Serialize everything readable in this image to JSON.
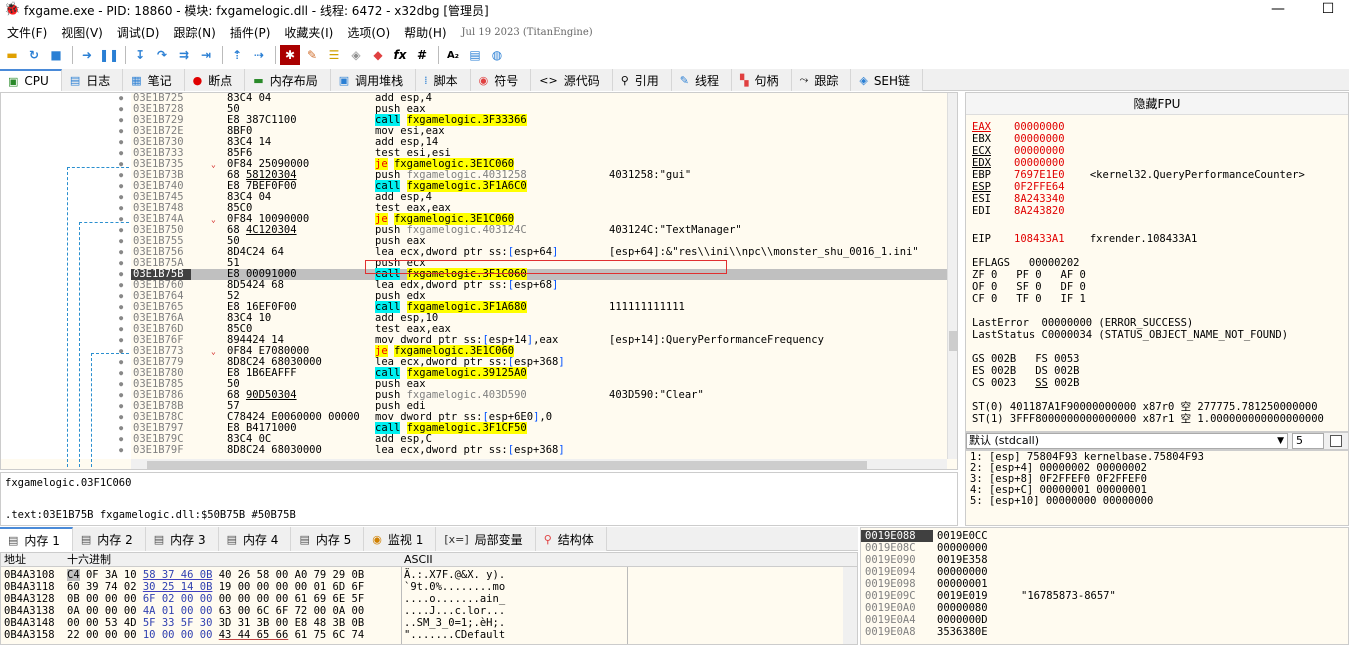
{
  "window": {
    "title": "fxgame.exe - PID: 18860 - 模块: fxgamelogic.dll - 线程: 6472 - x32dbg [管理员]",
    "app_icon": "bug-icon",
    "min_glyph": "—",
    "max_glyph": "☐"
  },
  "menu": [
    "文件(F)",
    "视图(V)",
    "调试(D)",
    "跟踪(N)",
    "插件(P)",
    "收藏夹(I)",
    "选项(O)",
    "帮助(H)"
  ],
  "build_date": "Jul 19 2023 (TitanEngine)",
  "toolbar": [
    "open-icon",
    "restart-icon",
    "stop-icon",
    "run-icon",
    "pause-icon",
    "step-into-icon",
    "step-over-icon",
    "trace-into-icon",
    "trace-over-icon",
    "execute-till-return-icon",
    "run-to-user-code-icon",
    "scylla-icon",
    "patch-icon",
    "comment-icon",
    "label-icon",
    "bookmark-icon",
    "function-icon",
    "hash-icon",
    "font-icon",
    "list-icon",
    "globe-icon"
  ],
  "tabs": [
    {
      "label": "CPU",
      "icon": "cpu-icon"
    },
    {
      "label": "日志",
      "icon": "log-icon"
    },
    {
      "label": "笔记",
      "icon": "notes-icon"
    },
    {
      "label": "断点",
      "icon": "breakpoint-icon"
    },
    {
      "label": "内存布局",
      "icon": "memory-map-icon"
    },
    {
      "label": "调用堆栈",
      "icon": "callstack-icon"
    },
    {
      "label": "脚本",
      "icon": "script-icon"
    },
    {
      "label": "符号",
      "icon": "symbol-icon"
    },
    {
      "label": "源代码",
      "icon": "source-icon"
    },
    {
      "label": "引用",
      "icon": "references-icon"
    },
    {
      "label": "线程",
      "icon": "threads-icon"
    },
    {
      "label": "句柄",
      "icon": "handles-icon"
    },
    {
      "label": "跟踪",
      "icon": "trace-icon"
    },
    {
      "label": "SEH链",
      "icon": "seh-icon"
    }
  ],
  "disasm": [
    {
      "addr": "03E1B725",
      "bytes": "83C4 04",
      "instr": "add esp,4",
      "cmt": ""
    },
    {
      "addr": "03E1B728",
      "bytes": "50",
      "instr": "push eax",
      "cmt": ""
    },
    {
      "addr": "03E1B729",
      "bytes": "E8 387C1100",
      "instr": "call fxgamelogic.3F33366",
      "cmt": "",
      "hl": "call"
    },
    {
      "addr": "03E1B72E",
      "bytes": "8BF0",
      "instr": "mov esi,eax",
      "cmt": ""
    },
    {
      "addr": "03E1B730",
      "bytes": "83C4 14",
      "instr": "add esp,14",
      "cmt": ""
    },
    {
      "addr": "03E1B733",
      "bytes": "85F6",
      "instr": "test esi,esi",
      "cmt": ""
    },
    {
      "addr": "03E1B735",
      "bytes": "0F84 25090000",
      "instr": "je fxgamelogic.3E1C060",
      "cmt": "",
      "hl": "je",
      "arrow": "v"
    },
    {
      "addr": "03E1B73B",
      "bytes": "68 58120304",
      "instr": "push fxgamelogic.4031258",
      "cmt": "4031258:\"gui\"",
      "bytes_ul": "58120304",
      "grey": true
    },
    {
      "addr": "03E1B740",
      "bytes": "E8 7BEF0F00",
      "instr": "call fxgamelogic.3F1A6C0",
      "cmt": "",
      "hl": "call"
    },
    {
      "addr": "03E1B745",
      "bytes": "83C4 04",
      "instr": "add esp,4",
      "cmt": ""
    },
    {
      "addr": "03E1B748",
      "bytes": "85C0",
      "instr": "test eax,eax",
      "cmt": ""
    },
    {
      "addr": "03E1B74A",
      "bytes": "0F84 10090000",
      "instr": "je fxgamelogic.3E1C060",
      "cmt": "",
      "hl": "je",
      "arrow": "v"
    },
    {
      "addr": "03E1B750",
      "bytes": "68 4C120304",
      "instr": "push fxgamelogic.403124C",
      "cmt": "403124C:\"TextManager\"",
      "bytes_ul": "4C120304",
      "grey": true
    },
    {
      "addr": "03E1B755",
      "bytes": "50",
      "instr": "push eax",
      "cmt": ""
    },
    {
      "addr": "03E1B756",
      "bytes": "8D4C24 64",
      "instr": "lea ecx,dword ptr ss:[esp+64]",
      "cmt": "[esp+64]:&\"res\\\\ini\\\\npc\\\\monster_shu_0016_1.ini\""
    },
    {
      "addr": "03E1B75A",
      "bytes": "51",
      "instr": "push ecx",
      "cmt": ""
    },
    {
      "addr": "03E1B75B",
      "bytes": "E8 00091000",
      "instr": "call fxgamelogic.3F1C060",
      "cmt": "",
      "hl": "call",
      "cur": true
    },
    {
      "addr": "03E1B760",
      "bytes": "8D5424 68",
      "instr": "lea edx,dword ptr ss:[esp+68]",
      "cmt": ""
    },
    {
      "addr": "03E1B764",
      "bytes": "52",
      "instr": "push edx",
      "cmt": ""
    },
    {
      "addr": "03E1B765",
      "bytes": "E8 16EF0F00",
      "instr": "call fxgamelogic.3F1A680",
      "cmt": "111111111111",
      "hl": "call"
    },
    {
      "addr": "03E1B76A",
      "bytes": "83C4 10",
      "instr": "add esp,10",
      "cmt": ""
    },
    {
      "addr": "03E1B76D",
      "bytes": "85C0",
      "instr": "test eax,eax",
      "cmt": ""
    },
    {
      "addr": "03E1B76F",
      "bytes": "894424 14",
      "instr": "mov dword ptr ss:[esp+14],eax",
      "cmt": "[esp+14]:QueryPerformanceFrequency"
    },
    {
      "addr": "03E1B773",
      "bytes": "0F84 E7080000",
      "instr": "je fxgamelogic.3E1C060",
      "cmt": "",
      "hl": "je",
      "arrow": "v"
    },
    {
      "addr": "03E1B779",
      "bytes": "8D8C24 68030000",
      "instr": "lea ecx,dword ptr ss:[esp+368]",
      "cmt": ""
    },
    {
      "addr": "03E1B780",
      "bytes": "E8 1B6EAFFF",
      "instr": "call fxgamelogic.39125A0",
      "cmt": "",
      "hl": "call"
    },
    {
      "addr": "03E1B785",
      "bytes": "50",
      "instr": "push eax",
      "cmt": ""
    },
    {
      "addr": "03E1B786",
      "bytes": "68 90D50304",
      "instr": "push fxgamelogic.403D590",
      "cmt": "403D590:\"Clear\"",
      "bytes_ul": "90D50304",
      "grey": true
    },
    {
      "addr": "03E1B78B",
      "bytes": "57",
      "instr": "push edi",
      "cmt": ""
    },
    {
      "addr": "03E1B78C",
      "bytes": "C78424 E0060000 00000",
      "instr": "mov dword ptr ss:[esp+6E0],0",
      "cmt": ""
    },
    {
      "addr": "03E1B797",
      "bytes": "E8 B4171000",
      "instr": "call fxgamelogic.3F1CF50",
      "cmt": "",
      "hl": "call"
    },
    {
      "addr": "03E1B79C",
      "bytes": "83C4 0C",
      "instr": "add esp,C",
      "cmt": ""
    },
    {
      "addr": "03E1B79F",
      "bytes": "8D8C24 68030000",
      "instr": "lea ecx,dword ptr ss:[esp+368]",
      "cmt": ""
    }
  ],
  "info": {
    "line1": "fxgamelogic.03F1C060",
    "line2": ".text:03E1B75B fxgamelogic.dll:$50B75B #50B75B"
  },
  "regs": {
    "header": "隐藏FPU",
    "list": [
      {
        "n": "EAX",
        "v": "00000000",
        "ul": true,
        "red": true
      },
      {
        "n": "EBX",
        "v": "00000000"
      },
      {
        "n": "ECX",
        "v": "00000000",
        "ul": true
      },
      {
        "n": "EDX",
        "v": "00000000",
        "ul": true
      },
      {
        "n": "EBP",
        "v": "7697E1E0",
        "c": "<kernel32.QueryPerformanceCounter>"
      },
      {
        "n": "ESP",
        "v": "0F2FFE64",
        "ul": true
      },
      {
        "n": "ESI",
        "v": "8A243340"
      },
      {
        "n": "EDI",
        "v": "8A243820"
      }
    ],
    "eip": {
      "n": "EIP",
      "v": "108433A1",
      "c": "fxrender.108433A1"
    },
    "eflags": "EFLAGS   00000202",
    "flags1": "ZF 0   PF 0   AF 0",
    "flags2": "OF 0   SF 0   DF 0",
    "flags3": "CF 0   TF 0   IF 1",
    "lasterr": "LastError  00000000 (ERROR_SUCCESS)",
    "laststatus": "LastStatus C0000034 (STATUS_OBJECT_NAME_NOT_FOUND)",
    "seg1": "GS 002B   FS 0053",
    "seg2": "ES 002B   DS 002B",
    "seg3a": "CS 0023   ",
    "seg3b": "SS",
    "seg3c": " 002B",
    "st0": "ST(0) 401187A1F90000000000 x87r0 空 277775.781250000000",
    "st1": "ST(1) 3FFF8000000000000000 x87r1 空 1.000000000000000000"
  },
  "callconv": {
    "label": "默认 (stdcall)",
    "count": "5"
  },
  "args": [
    "1: [esp] 75804F93 kernelbase.75804F93",
    "2: [esp+4] 00000002 00000002",
    "3: [esp+8] 0F2FFEF0 0F2FFEF0",
    "4: [esp+C] 00000001 00000001",
    "5: [esp+10] 00000000 00000000"
  ],
  "dumptabs": [
    {
      "label": "内存 1",
      "icon": "memory-icon"
    },
    {
      "label": "内存 2",
      "icon": "memory-icon"
    },
    {
      "label": "内存 3",
      "icon": "memory-icon"
    },
    {
      "label": "内存 4",
      "icon": "memory-icon"
    },
    {
      "label": "内存 5",
      "icon": "memory-icon"
    },
    {
      "label": "监视 1",
      "icon": "watch-icon"
    },
    {
      "label": "局部变量",
      "icon": "locals-icon"
    },
    {
      "label": "结构体",
      "icon": "struct-icon"
    }
  ],
  "dump": {
    "hdr_addr": "地址",
    "hdr_hex": "十六进制",
    "hdr_ascii": "ASCII",
    "rows": [
      {
        "a": "0B4A3108",
        "h1": "C4 0F 3A 10",
        "h2": "58 37 46 0B",
        "h3": "40 26 58 00",
        "h4": "A0 79 29 0B",
        "s": "Ä.:.X7F.@&X. y)."
      },
      {
        "a": "0B4A3118",
        "h1": "60 39 74 02",
        "h2": "30 25 14 0B",
        "h3": "19 00 00 00",
        "h4": "00 01 6D 6F",
        "s": "`9t.0%........mo"
      },
      {
        "a": "0B4A3128",
        "h1": "0B 00 00 00",
        "h2": "6F 02 00 00",
        "h3": "00 00 00 00",
        "h4": "61 69 6E 5F",
        "s": "....o.......ain_"
      },
      {
        "a": "0B4A3138",
        "h1": "0A 00 00 00",
        "h2": "4A 01 00 00",
        "h3": "63 00 6C 6F",
        "h4": "72 00 0A 00",
        "s": "....J...c.lor..."
      },
      {
        "a": "0B4A3148",
        "h1": "00 00 53 4D",
        "h2": "5F 33 5F 30",
        "h3": "3D 31 3B 00",
        "h4": "E8 48 3B 0B",
        "s": "..SM_3_0=1;.èH;."
      },
      {
        "a": "0B4A3158",
        "h1": "22 00 00 00",
        "h2": "10 00 00 00",
        "h3": "43 44 65 66",
        "h4": "61 75 6C 74",
        "s": "\".......CDefault"
      }
    ]
  },
  "stack": [
    {
      "a": "0019E088",
      "v": "0019E0CC",
      "c": ""
    },
    {
      "a": "0019E08C",
      "v": "00000000",
      "c": ""
    },
    {
      "a": "0019E090",
      "v": "0019E358",
      "c": ""
    },
    {
      "a": "0019E094",
      "v": "00000000",
      "c": ""
    },
    {
      "a": "0019E098",
      "v": "00000001",
      "c": ""
    },
    {
      "a": "0019E09C",
      "v": "0019E019",
      "c": "\"16785873-8657\""
    },
    {
      "a": "0019E0A0",
      "v": "00000080",
      "c": ""
    },
    {
      "a": "0019E0A4",
      "v": "0000000D",
      "c": ""
    },
    {
      "a": "0019E0A8",
      "v": "3536380E",
      "c": ""
    }
  ]
}
